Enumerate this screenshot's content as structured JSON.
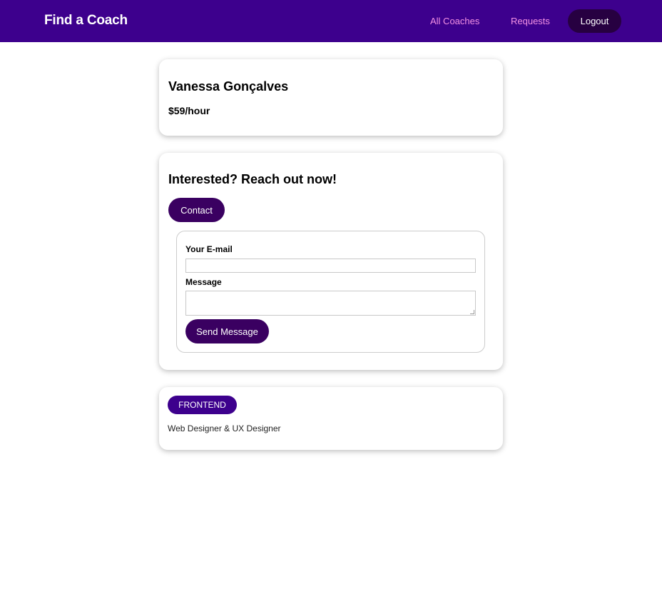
{
  "header": {
    "brand": "Find a Coach",
    "nav": {
      "all_coaches": "All Coaches",
      "requests": "Requests",
      "logout": "Logout"
    }
  },
  "coach": {
    "name": "Vanessa Gonçalves",
    "rate": "$59/hour"
  },
  "contact": {
    "title": "Interested? Reach out now!",
    "contact_button": "Contact",
    "form": {
      "email_label": "Your E-mail",
      "email_value": "",
      "message_label": "Message",
      "message_value": "",
      "send_button": "Send Message"
    }
  },
  "details": {
    "areas": [
      "FRONTEND"
    ],
    "description": "Web Designer & UX Designer"
  },
  "colors": {
    "header_bg": "#3d008d",
    "nav_link": "#f391e3",
    "button_dark": "#3a0061",
    "badge_bg": "#3d008d"
  }
}
